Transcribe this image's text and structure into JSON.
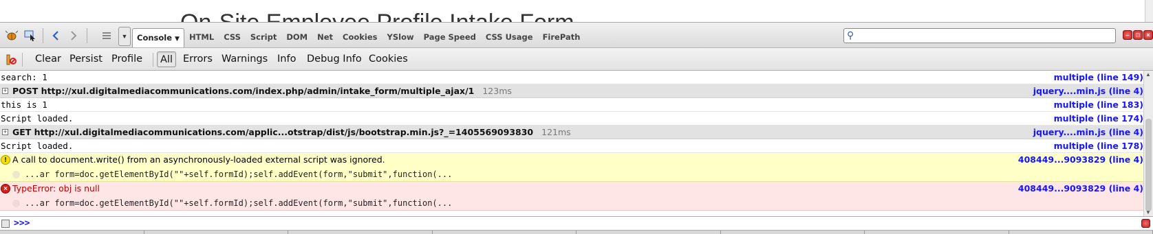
{
  "page": {
    "title_fragment": "On-Site Employee Profile Intake Form"
  },
  "toolbar": {
    "icons": [
      "firebug-icon",
      "inspect-icon",
      "back-arrow-icon",
      "forward-arrow-icon",
      "list-icon"
    ],
    "tabs": [
      {
        "label": "Console",
        "active": true
      },
      {
        "label": "HTML"
      },
      {
        "label": "CSS"
      },
      {
        "label": "Script"
      },
      {
        "label": "DOM"
      },
      {
        "label": "Net"
      },
      {
        "label": "Cookies"
      },
      {
        "label": "YSlow"
      },
      {
        "label": "Page Speed"
      },
      {
        "label": "CSS Usage"
      },
      {
        "label": "FirePath"
      }
    ],
    "search_placeholder": ""
  },
  "console": {
    "actions": {
      "clear": "Clear",
      "persist": "Persist",
      "profile": "Profile"
    },
    "filters": {
      "all": "All",
      "errors": "Errors",
      "warnings": "Warnings",
      "info": "Info",
      "debug_info": "Debug Info",
      "cookies": "Cookies"
    }
  },
  "log": {
    "rows": [
      {
        "type": "log",
        "text": "search: 1",
        "source": "multiple (line 149)"
      },
      {
        "type": "net",
        "text": "POST http://xul.digitalmediacommunications.com/index.php/admin/intake_form/multiple_ajax/1",
        "time": "123ms",
        "source": "jquery....min.js (line 4)"
      },
      {
        "type": "log",
        "text": "this is 1",
        "source": "multiple (line 183)"
      },
      {
        "type": "log",
        "text": "Script loaded.",
        "source": "multiple (line 174)"
      },
      {
        "type": "net",
        "text": "GET http://xul.digitalmediacommunications.com/applic...otstrap/dist/js/bootstrap.min.js?_=1405569093830",
        "time": "121ms",
        "source": "jquery....min.js (line 4)"
      },
      {
        "type": "log",
        "text": "Script loaded.",
        "source": "multiple (line 178)"
      },
      {
        "type": "warning",
        "text": "A call to document.write() from an asynchronously-loaded external script was ignored.",
        "code": "...ar form=doc.getElementById(\"\"+self.formId);self.addEvent(form,\"submit\",function(...",
        "source": "408449...9093829 (line 4)"
      },
      {
        "type": "error",
        "text": "TypeError: obj is null",
        "code": "...ar form=doc.getElementById(\"\"+self.formId);self.addEvent(form,\"submit\",function(...",
        "source": "408449...9093829 (line 4)"
      }
    ]
  },
  "cmdline": {
    "prompt": ">>>"
  },
  "colors": {
    "link": "#1414ff",
    "warning_bg": "#ffffc8",
    "error_bg": "#ffe6e6",
    "error_text": "#c00000"
  }
}
